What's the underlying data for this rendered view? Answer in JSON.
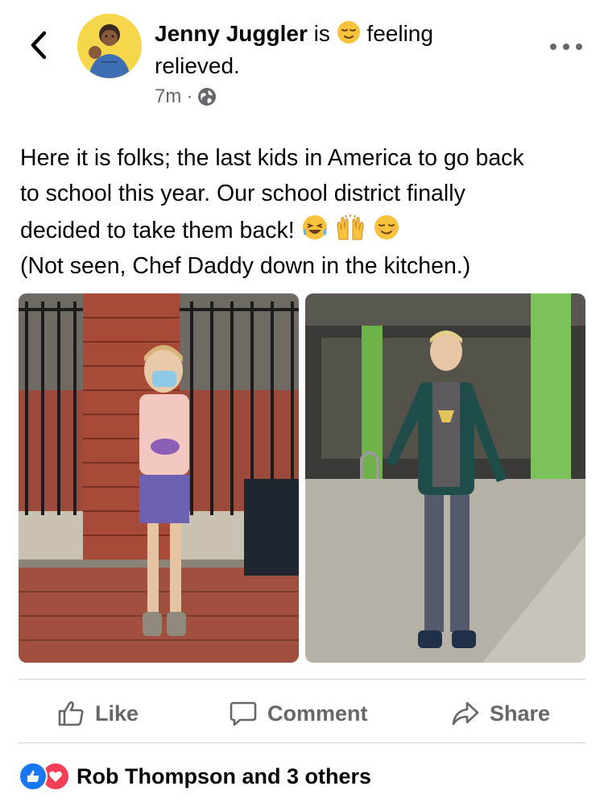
{
  "post": {
    "author": "Jenny Juggler",
    "is_text": "is",
    "feeling_text": "feeling",
    "feeling_value": "relieved.",
    "time": "7m",
    "separator": "·",
    "audience_icon": "globe-icon",
    "body_lines": [
      "Here it is folks; the last kids in America to go back",
      "to school this year.  Our school district finally",
      "decided to take them back!",
      "(Not seen, Chef Daddy down in the kitchen.)"
    ],
    "body_emojis": [
      "laughing-crying-emoji",
      "raised-hands-emoji",
      "relieved-face-emoji"
    ]
  },
  "actions": {
    "like": "Like",
    "comment": "Comment",
    "share": "Share"
  },
  "reactions": {
    "summary": "Rob Thompson and 3 others",
    "types": [
      "like",
      "love"
    ]
  },
  "colors": {
    "facebook_blue": "#1877f2",
    "love_red": "#f33e58",
    "secondary_text": "#65676b",
    "divider": "#ced0d4"
  }
}
